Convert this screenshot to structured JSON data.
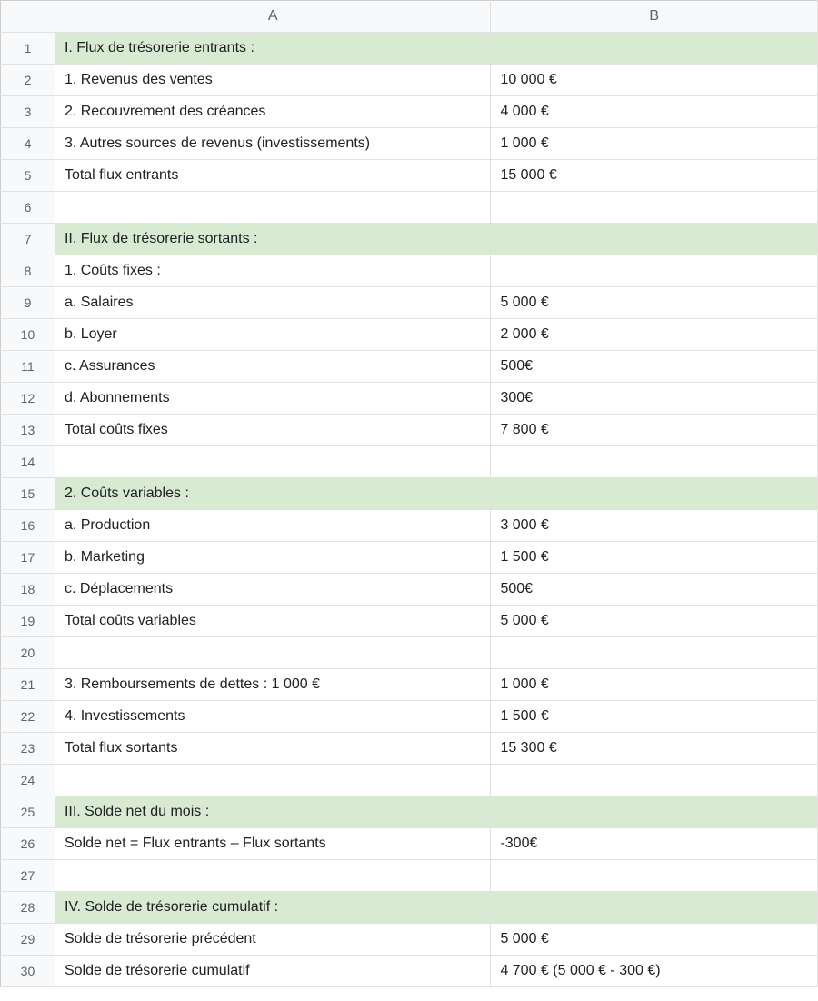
{
  "columns": {
    "A": "A",
    "B": "B"
  },
  "rows": [
    {
      "n": "1",
      "a": "I. Flux de trésorerie entrants :",
      "b": "",
      "section": true
    },
    {
      "n": "2",
      "a": "1. Revenus des ventes",
      "b": "10 000 €",
      "section": false
    },
    {
      "n": "3",
      "a": "2. Recouvrement des créances",
      "b": "4 000 €",
      "section": false
    },
    {
      "n": "4",
      "a": "3. Autres sources de revenus (investissements)",
      "b": "1 000 €",
      "section": false
    },
    {
      "n": "5",
      "a": "Total flux entrants",
      "b": "15 000 €",
      "section": false
    },
    {
      "n": "6",
      "a": "",
      "b": "",
      "section": false
    },
    {
      "n": "7",
      "a": "II. Flux de trésorerie sortants :",
      "b": "",
      "section": true
    },
    {
      "n": "8",
      "a": "1. Coûts fixes :",
      "b": "",
      "section": false
    },
    {
      "n": "9",
      "a": "a. Salaires",
      "b": "5 000 €",
      "section": false
    },
    {
      "n": "10",
      "a": "b. Loyer",
      "b": "2 000 €",
      "section": false
    },
    {
      "n": "11",
      "a": "c. Assurances",
      "b": "500€",
      "section": false
    },
    {
      "n": "12",
      "a": "d. Abonnements",
      "b": "300€",
      "section": false
    },
    {
      "n": "13",
      "a": "Total coûts fixes",
      "b": "7 800 €",
      "section": false
    },
    {
      "n": "14",
      "a": "",
      "b": "",
      "section": false
    },
    {
      "n": "15",
      "a": "2. Coûts variables :",
      "b": "",
      "section": true
    },
    {
      "n": "16",
      "a": "a. Production",
      "b": "3 000 €",
      "section": false
    },
    {
      "n": "17",
      "a": "b. Marketing",
      "b": "1 500 €",
      "section": false
    },
    {
      "n": "18",
      "a": "c. Déplacements",
      "b": "500€",
      "section": false
    },
    {
      "n": "19",
      "a": "Total coûts variables",
      "b": "5 000 €",
      "section": false
    },
    {
      "n": "20",
      "a": "",
      "b": "",
      "section": false
    },
    {
      "n": "21",
      "a": "3. Remboursements de dettes : 1 000 €",
      "b": "1 000 €",
      "section": false
    },
    {
      "n": "22",
      "a": "4. Investissements",
      "b": "1 500 €",
      "section": false
    },
    {
      "n": "23",
      "a": "Total flux sortants",
      "b": "15 300 €",
      "section": false
    },
    {
      "n": "24",
      "a": "",
      "b": "",
      "section": false
    },
    {
      "n": "25",
      "a": "III. Solde net du mois :",
      "b": "",
      "section": true
    },
    {
      "n": "26",
      "a": "Solde net = Flux entrants – Flux sortants",
      "b": "-300€",
      "section": false
    },
    {
      "n": "27",
      "a": "",
      "b": "",
      "section": false
    },
    {
      "n": "28",
      "a": "IV. Solde de trésorerie cumulatif :",
      "b": "",
      "section": true
    },
    {
      "n": "29",
      "a": "Solde de trésorerie précédent",
      "b": "5 000 €",
      "section": false
    },
    {
      "n": "30",
      "a": "Solde de trésorerie cumulatif",
      "b": "4 700 € (5 000 € - 300 €)",
      "section": false
    }
  ]
}
